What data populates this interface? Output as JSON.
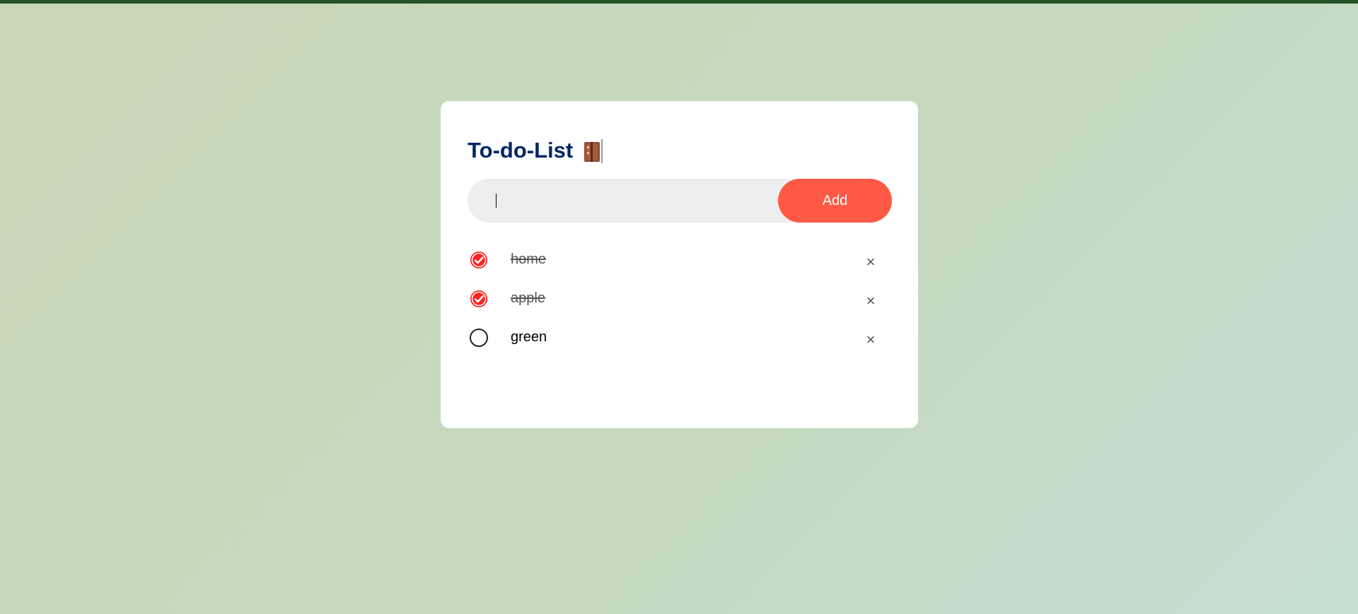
{
  "title": "To-do-List",
  "title_icon": "notebook-icon",
  "input": {
    "value": "",
    "placeholder": ""
  },
  "add_button_label": "Add",
  "colors": {
    "accent": "#ff5945",
    "title": "#002765",
    "top_bar": "#245428",
    "check": "#ff1f1f"
  },
  "tasks": [
    {
      "label": "home",
      "done": true,
      "delete_symbol": "×"
    },
    {
      "label": "apple",
      "done": true,
      "delete_symbol": "×"
    },
    {
      "label": "green",
      "done": false,
      "delete_symbol": "×"
    }
  ]
}
